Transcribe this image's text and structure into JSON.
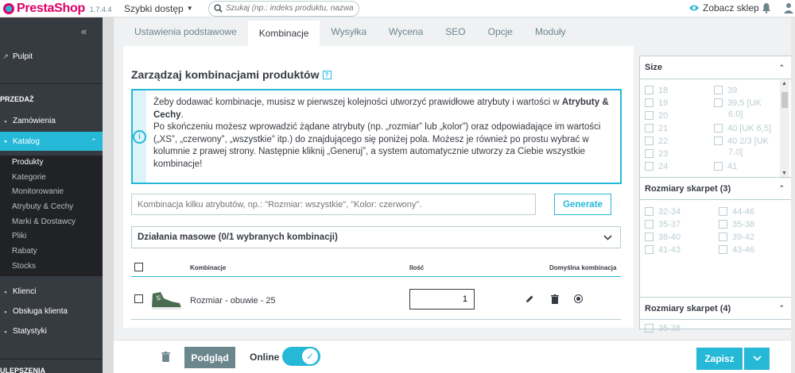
{
  "header": {
    "brand": "PrestaShop",
    "version": "1.7.4.4",
    "quick_access": "Szybki dostęp",
    "search_placeholder": "Szukaj (np.: indeks produktu, nazwa klie",
    "view_store": "Zobacz sklep",
    "icons": [
      "search-icon",
      "eye-icon",
      "bell-icon",
      "user-icon"
    ]
  },
  "sidebar": {
    "collapse_label": "«",
    "dashboard": "Pulpit",
    "section_sell": "PRZEDAŻ",
    "orders": "Zamówienia",
    "catalog": "Katalog",
    "catalog_sub": [
      "Produkty",
      "Kategorie",
      "Monitorowanie",
      "Atrybuty & Cechy",
      "Marki & Dostawcy",
      "Pliki",
      "Rabaty",
      "Stocks"
    ],
    "customers": "Klienci",
    "customer_service": "Obsługa klienta",
    "stats": "Statystyki",
    "section_more": "ULEPSZENIA"
  },
  "tabs": [
    "Ustawienia podstawowe",
    "Kombinacje",
    "Wysyłka",
    "Wycena",
    "SEO",
    "Opcje",
    "Moduły"
  ],
  "active_tab": "Kombinacje",
  "main": {
    "title": "Zarządzaj kombinacjami produktów",
    "help_label": "?",
    "alert": {
      "line1_pre": "Żeby dodawać kombinacje, musisz w pierwszej kolejności utworzyć prawidłowe atrybuty i wartości w ",
      "line1_bold": "Atrybuty & Cechy",
      "line1_post": ".",
      "line2": "Po skończeniu możesz wprowadzić żądane atrybuty (np. „rozmiar” lub „kolor”) oraz odpowiadające im wartości („XS”, „czerwony”, „wszystkie” itp.) do znajdującego się poniżej pola. Możesz je również po prostu wybrać w kolumnie z prawej strony. Następnie kliknij „Generuj”, a system automatycznie utworzy za Ciebie wszystkie kombinacje!"
    },
    "combination_placeholder": "Kombinacja kilku atrybutów, np.: \"Rozmiar: wszystkie\", \"Kolor: czerwony\".",
    "generate_label": "Generate",
    "bulk_label": "Działania masowe (0/1 wybranych kombinacji)",
    "table": {
      "headers": {
        "combination": "Kombinacje",
        "quantity": "Ilość",
        "default": "Domyślna kombinacja"
      },
      "rows": [
        {
          "name": "Rozmiar - obuwie - 25",
          "quantity": "1",
          "default": true
        }
      ]
    }
  },
  "attributes": {
    "size": {
      "title": "Size",
      "col1": [
        "18",
        "19",
        "20",
        "21",
        "22",
        "23",
        "24"
      ],
      "col2": [
        "39",
        "39,5 [UK",
        "6.0]",
        "40 [UK 6,5]",
        "40 2/3 [UK",
        "7.0]",
        "41"
      ]
    },
    "socks3": {
      "title": "Rozmiary skarpet (3)",
      "col1": [
        "32-34",
        "35-37",
        "38-40",
        "41-43"
      ],
      "col2": [
        "44-46",
        "35-38",
        "39-42",
        "43-46"
      ]
    },
    "socks4": {
      "title": "Rozmiary skarpet (4)",
      "first": "35-38"
    }
  },
  "footer": {
    "preview": "Podgląd",
    "online": "Online",
    "online_enabled": true,
    "save": "Zapisz"
  },
  "colors": {
    "accent": "#25b9d7",
    "brand": "#df0067",
    "sidebar": "#363a41",
    "text": "#363a41"
  }
}
